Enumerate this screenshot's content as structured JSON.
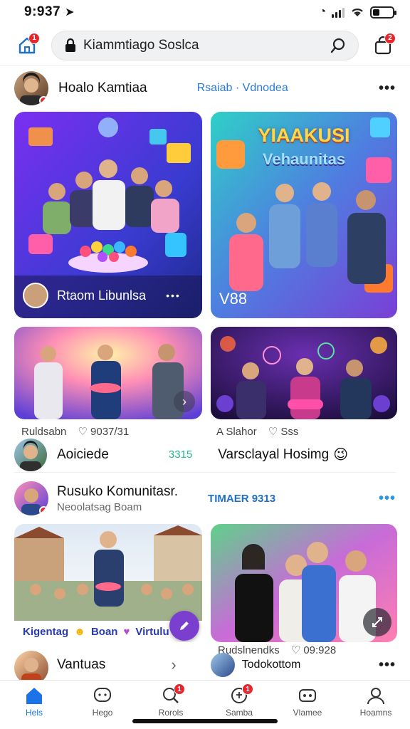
{
  "status": {
    "time": "9:937"
  },
  "topbar": {
    "search_text": "Kiammtiago Soslca",
    "home_badge": "1",
    "bag_badge": "2"
  },
  "post1": {
    "author": "Hoalo Kamtiaa",
    "tag": "Rsaiab · Vdnodea",
    "more": "•••"
  },
  "cards": {
    "c1_caption": "Rtaom Libunlsa",
    "c1_dots": "•••",
    "c2_title": "YIAAKUSI",
    "c2_subtitle": "Vehaunitas",
    "c2_caption": "V88"
  },
  "meta1": {
    "left": "Ruldsabn",
    "left_count": "♡ 9037/31",
    "right": "A Slahor",
    "right_count": "♡ Sss"
  },
  "row_a": {
    "name": "Aoiciede",
    "count": "3315",
    "title": "Varsclayal Hosimg",
    "emoji": "😉"
  },
  "post2": {
    "name": "Rusuko Komunitasr.",
    "sub": "Neoolatsag Boam",
    "tag": "TIMAER 9313",
    "more": "•••"
  },
  "card_caption_bottom": {
    "left": "Kigentag",
    "mid": "Boan",
    "right": "Virtulu"
  },
  "meta2": {
    "left": "Rudslnendks",
    "count": "♡ 09:928"
  },
  "row_b": {
    "name": "Vantuas",
    "chev": "›",
    "right_name": "Todokottom",
    "more": "•••"
  },
  "nav": {
    "items": [
      {
        "label": "Hels",
        "icon": "home-icon",
        "badge": ""
      },
      {
        "label": "Hego",
        "icon": "chat-icon",
        "badge": ""
      },
      {
        "label": "Rorols",
        "icon": "search-icon",
        "badge": "1"
      },
      {
        "label": "Samba",
        "icon": "notification-icon",
        "badge": "1"
      },
      {
        "label": "Vlamee",
        "icon": "game-icon",
        "badge": ""
      },
      {
        "label": "Hoamns",
        "icon": "profile-icon",
        "badge": ""
      }
    ]
  },
  "colors": {
    "accent": "#1a73e8",
    "badge": "#e8262b",
    "fab": "#7b3fd0"
  }
}
